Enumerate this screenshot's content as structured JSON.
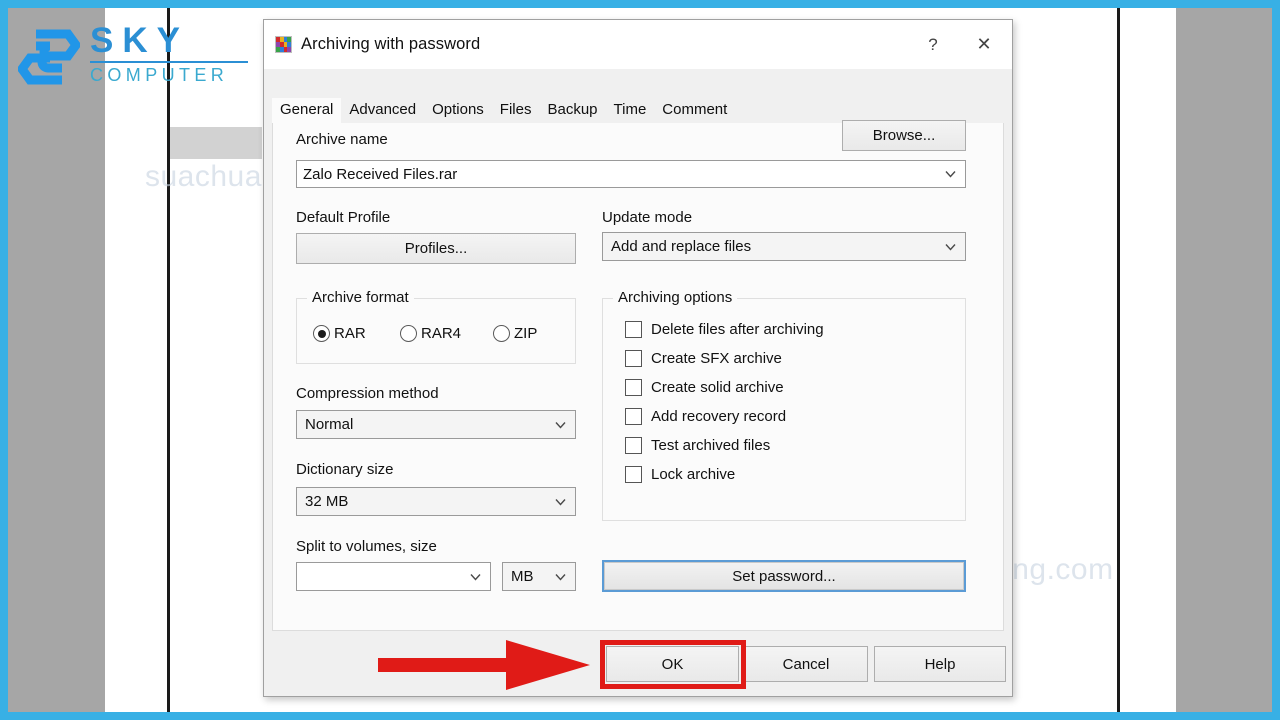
{
  "branding": {
    "logo_primary": "SKY",
    "logo_secondary": "COMPUTER",
    "logo_icon": "sky-hexagon-s-logo",
    "accent_color": "#2b8fd4",
    "frame_color": "#38b0e5"
  },
  "watermarks": {
    "left": "suachuamaytinhdanang.com",
    "right": "suachuamaytinhdanang.com"
  },
  "dialog": {
    "title": "Archiving with password",
    "icon": "winrar-books-icon",
    "titlebar_buttons": {
      "help": "?",
      "close": "✕"
    },
    "tabs": [
      {
        "label": "General",
        "active": true
      },
      {
        "label": "Advanced",
        "active": false
      },
      {
        "label": "Options",
        "active": false
      },
      {
        "label": "Files",
        "active": false
      },
      {
        "label": "Backup",
        "active": false
      },
      {
        "label": "Time",
        "active": false
      },
      {
        "label": "Comment",
        "active": false
      }
    ],
    "general": {
      "archive_name_label": "Archive name",
      "archive_name_value": "Zalo Received Files.rar",
      "browse_label": "Browse...",
      "default_profile_label": "Default Profile",
      "profiles_label": "Profiles...",
      "update_mode_label": "Update mode",
      "update_mode_value": "Add and replace files",
      "archive_format_label": "Archive format",
      "formats": [
        {
          "label": "RAR",
          "selected": true
        },
        {
          "label": "RAR4",
          "selected": false
        },
        {
          "label": "ZIP",
          "selected": false
        }
      ],
      "compression_method_label": "Compression method",
      "compression_method_value": "Normal",
      "dictionary_size_label": "Dictionary size",
      "dictionary_size_value": "32 MB",
      "split_label": "Split to volumes, size",
      "split_value": "",
      "split_unit_value": "MB",
      "archiving_options_label": "Archiving options",
      "archiving_options": [
        {
          "label": "Delete files after archiving",
          "checked": false
        },
        {
          "label": "Create SFX archive",
          "checked": false
        },
        {
          "label": "Create solid archive",
          "checked": false
        },
        {
          "label": "Add recovery record",
          "checked": false
        },
        {
          "label": "Test archived files",
          "checked": false
        },
        {
          "label": "Lock archive",
          "checked": false
        }
      ],
      "set_password_label": "Set password...",
      "set_password_focused": true
    },
    "footer": {
      "ok_label": "OK",
      "cancel_label": "Cancel",
      "help_label": "Help"
    }
  },
  "annotation": {
    "highlight_color": "#e01b17",
    "arrow_target": "OK",
    "arrow_name": "red-arrow-pointing-to-ok"
  }
}
